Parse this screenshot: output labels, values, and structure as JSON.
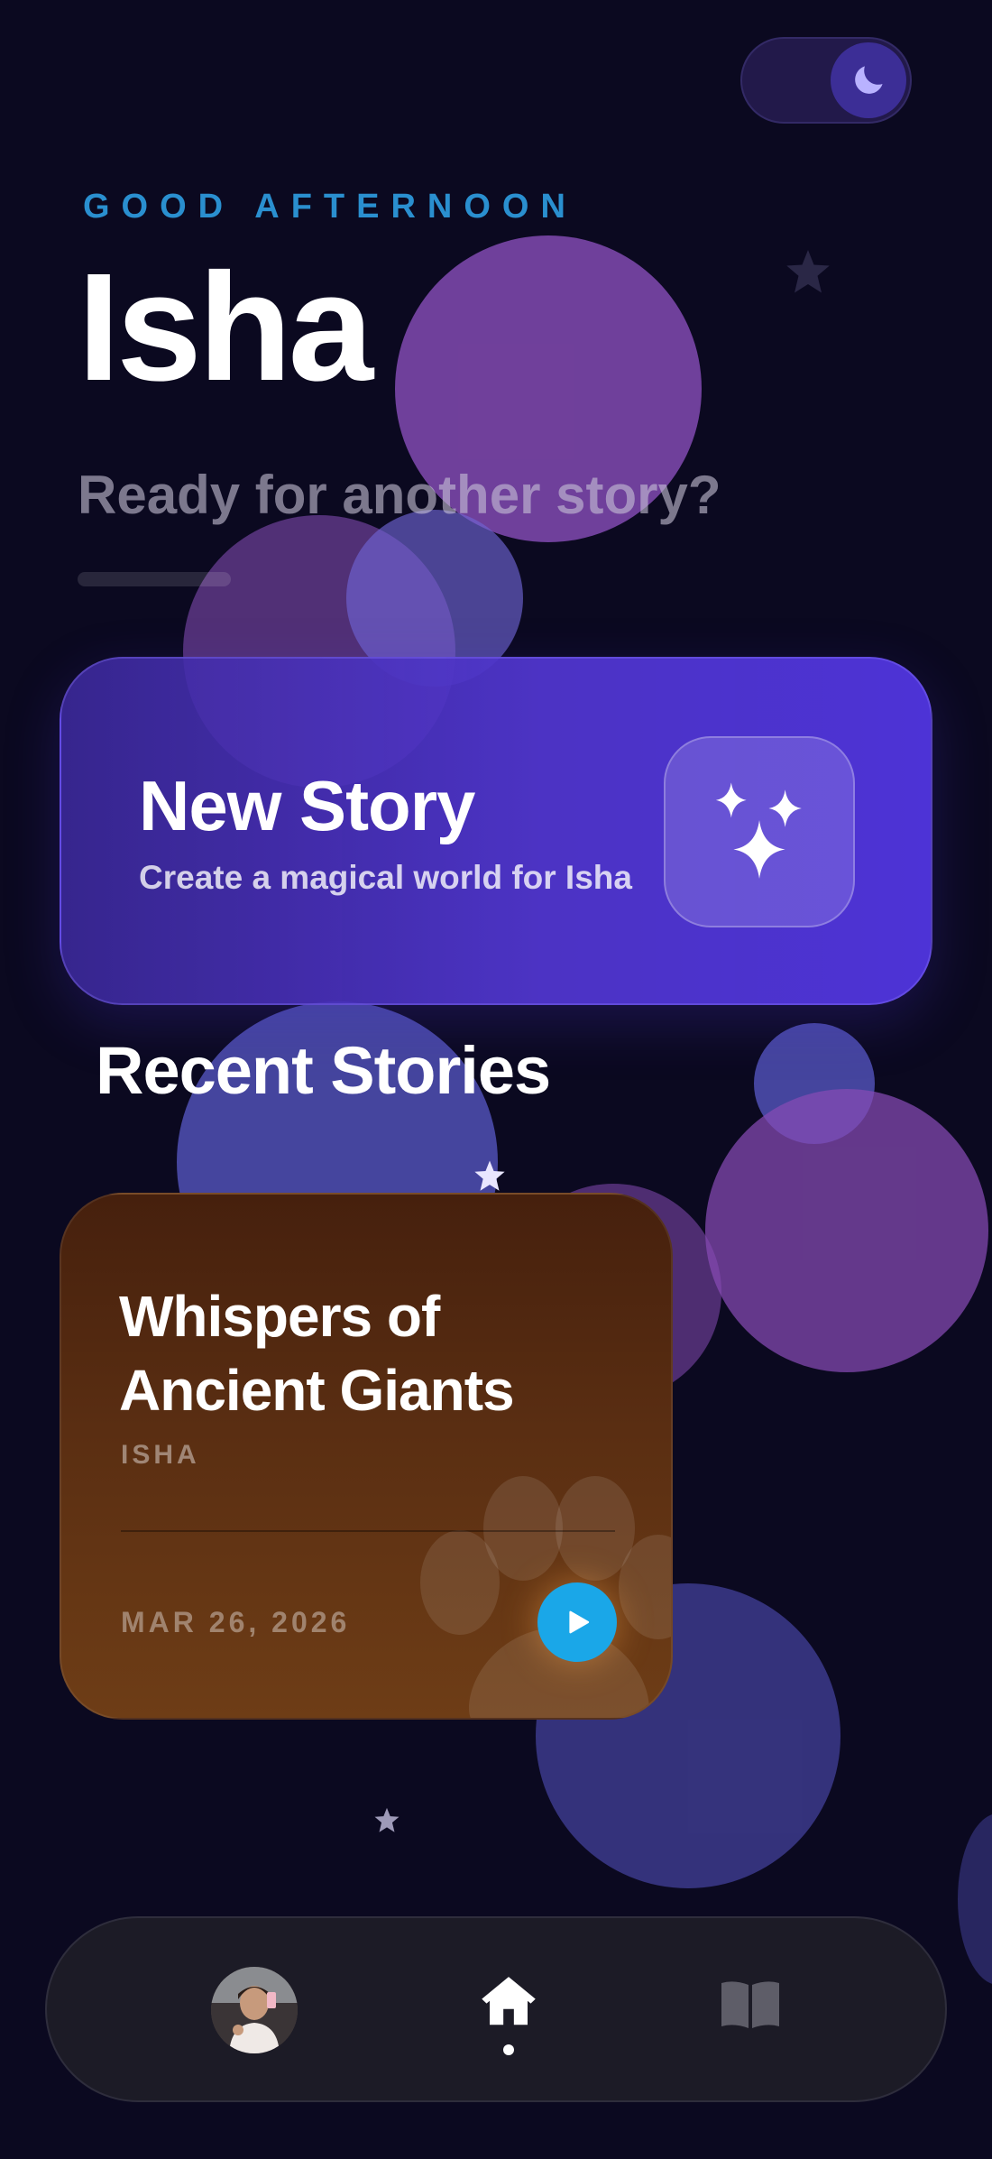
{
  "header": {
    "greeting": "GOOD AFTERNOON",
    "user_name": "Isha",
    "subtitle": "Ready for another story?"
  },
  "theme_toggle": {
    "mode": "dark",
    "icon": "moon-icon"
  },
  "new_story": {
    "title": "New Story",
    "subtitle": "Create a magical world for Isha",
    "icon": "sparkles-icon"
  },
  "recent": {
    "section_title": "Recent Stories",
    "stories": [
      {
        "title": "Whispers of Ancient Giants",
        "author": "ISHA",
        "date": "MAR 26, 2026",
        "decoration": "paw-print-icon",
        "action_icon": "play-icon"
      }
    ]
  },
  "bottom_nav": {
    "items": [
      {
        "name": "profile",
        "icon": "avatar"
      },
      {
        "name": "home",
        "icon": "home-icon",
        "active": true
      },
      {
        "name": "library",
        "icon": "book-icon"
      }
    ]
  },
  "colors": {
    "background": "#0b0920",
    "greeting": "#2a8fcf",
    "new_story_card": "#4d33d6",
    "story_card": "#5a2e12",
    "play_button": "#1aa7e8",
    "nav_bar": "#1c1b26"
  }
}
